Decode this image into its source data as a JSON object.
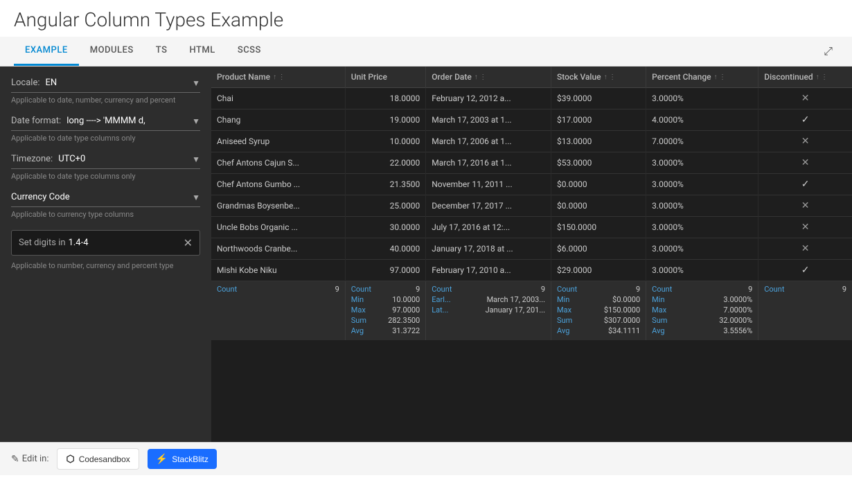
{
  "title": "Angular Column Types Example",
  "tabs": [
    {
      "label": "EXAMPLE",
      "active": true
    },
    {
      "label": "MODULES",
      "active": false
    },
    {
      "label": "TS",
      "active": false
    },
    {
      "label": "HTML",
      "active": false
    },
    {
      "label": "SCSS",
      "active": false
    }
  ],
  "left_panel": {
    "locale": {
      "label": "Locale:",
      "value": "EN",
      "hint": "Applicable to date, number, currency and percent"
    },
    "date_format": {
      "label": "Date format:",
      "value": "long ----> 'MMMM d,",
      "hint": "Applicable to date type columns only"
    },
    "timezone": {
      "label": "Timezone:",
      "value": "UTC+0",
      "hint": "Applicable to date type columns only"
    },
    "currency_code": {
      "label": "Currency Code",
      "hint": "Applicable to currency type columns"
    },
    "digits": {
      "label": "Set digits in",
      "value": "1.4-4",
      "hint": "Applicable to number, currency and percent type"
    }
  },
  "grid": {
    "columns": [
      {
        "label": "Product Name",
        "key": "product_name"
      },
      {
        "label": "Unit Price",
        "key": "unit_price"
      },
      {
        "label": "Order Date",
        "key": "order_date"
      },
      {
        "label": "Stock Value",
        "key": "stock_value"
      },
      {
        "label": "Percent Change",
        "key": "percent_change"
      },
      {
        "label": "Discontinued",
        "key": "discontinued"
      }
    ],
    "rows": [
      {
        "product_name": "Chai",
        "unit_price": "18.0000",
        "order_date": "February 12, 2012 a...",
        "stock_value": "$39.0000",
        "percent_change": "3.0000%",
        "discontinued": "cross"
      },
      {
        "product_name": "Chang",
        "unit_price": "19.0000",
        "order_date": "March 17, 2003 at 1...",
        "stock_value": "$17.0000",
        "percent_change": "4.0000%",
        "discontinued": "check"
      },
      {
        "product_name": "Aniseed Syrup",
        "unit_price": "10.0000",
        "order_date": "March 17, 2006 at 1...",
        "stock_value": "$13.0000",
        "percent_change": "7.0000%",
        "discontinued": "cross"
      },
      {
        "product_name": "Chef Antons Cajun S...",
        "unit_price": "22.0000",
        "order_date": "March 17, 2016 at 1...",
        "stock_value": "$53.0000",
        "percent_change": "3.0000%",
        "discontinued": "cross"
      },
      {
        "product_name": "Chef Antons Gumbo ...",
        "unit_price": "21.3500",
        "order_date": "November 11, 2011 ...",
        "stock_value": "$0.0000",
        "percent_change": "3.0000%",
        "discontinued": "check"
      },
      {
        "product_name": "Grandmas Boysenbe...",
        "unit_price": "25.0000",
        "order_date": "December 17, 2017 ...",
        "stock_value": "$0.0000",
        "percent_change": "3.0000%",
        "discontinued": "cross"
      },
      {
        "product_name": "Uncle Bobs Organic ...",
        "unit_price": "30.0000",
        "order_date": "July 17, 2016 at 12:...",
        "stock_value": "$150.0000",
        "percent_change": "3.0000%",
        "discontinued": "cross"
      },
      {
        "product_name": "Northwoods Cranbe...",
        "unit_price": "40.0000",
        "order_date": "January 17, 2018 at ...",
        "stock_value": "$6.0000",
        "percent_change": "3.0000%",
        "discontinued": "cross"
      },
      {
        "product_name": "Mishi Kobe Niku",
        "unit_price": "97.0000",
        "order_date": "February 17, 2010 a...",
        "stock_value": "$29.0000",
        "percent_change": "3.0000%",
        "discontinued": "check"
      }
    ],
    "footer": {
      "product": [
        {
          "label": "Count",
          "value": "9"
        }
      ],
      "unit_price": [
        {
          "label": "Count",
          "value": "9"
        },
        {
          "label": "Min",
          "value": "10.0000"
        },
        {
          "label": "Max",
          "value": "97.0000"
        },
        {
          "label": "Sum",
          "value": "282.3500"
        },
        {
          "label": "Avg",
          "value": "31.3722"
        }
      ],
      "order_date": [
        {
          "label": "Count",
          "value": "9"
        },
        {
          "label": "Earl...",
          "value": "March 17, 2003..."
        },
        {
          "label": "Lat...",
          "value": "January 17, 201..."
        }
      ],
      "stock_value": [
        {
          "label": "Count",
          "value": "9"
        },
        {
          "label": "Min",
          "value": "$0.0000"
        },
        {
          "label": "Max",
          "value": "$150.0000"
        },
        {
          "label": "Sum",
          "value": "$307.0000"
        },
        {
          "label": "Avg",
          "value": "$34.1111"
        }
      ],
      "percent_change": [
        {
          "label": "Count",
          "value": "9"
        },
        {
          "label": "Min",
          "value": "3.0000%"
        },
        {
          "label": "Max",
          "value": "7.0000%"
        },
        {
          "label": "Sum",
          "value": "32.0000%"
        },
        {
          "label": "Avg",
          "value": "3.5556%"
        }
      ],
      "discontinued": [
        {
          "label": "Count",
          "value": "9"
        }
      ]
    }
  },
  "bottom_bar": {
    "edit_label": "Edit in:",
    "codesandbox_label": "Codesandbox",
    "stackblitz_label": "StackBlitz"
  }
}
